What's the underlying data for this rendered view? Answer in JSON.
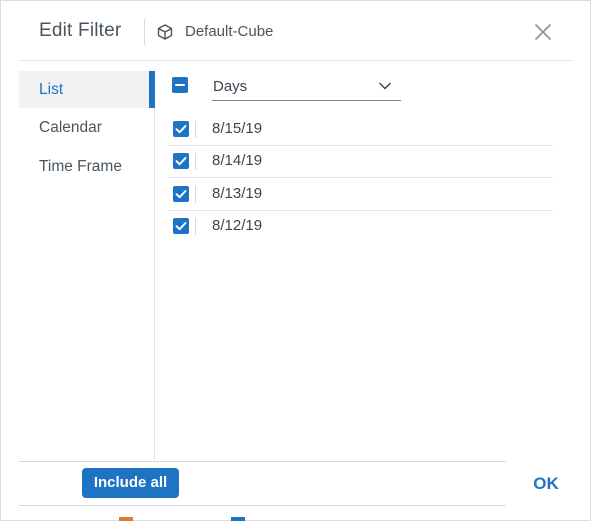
{
  "dialog": {
    "title": "Edit Filter",
    "cube_name": "Default-Cube"
  },
  "sidebar": {
    "items": [
      {
        "label": "List",
        "active": true
      },
      {
        "label": "Calendar",
        "active": false
      },
      {
        "label": "Time Frame",
        "active": false
      }
    ]
  },
  "list": {
    "select_all_state": "partial",
    "level_select": {
      "value": "Days"
    },
    "rows": [
      {
        "label": "8/15/19",
        "checked": true
      },
      {
        "label": "8/14/19",
        "checked": true
      },
      {
        "label": "8/13/19",
        "checked": true
      },
      {
        "label": "8/12/19",
        "checked": true
      }
    ]
  },
  "footer": {
    "include_all_label": "Include all",
    "ok_label": "OK"
  },
  "colors": {
    "accent": "#1f73c4",
    "text": "#4a5560",
    "border": "#e2e4e7"
  }
}
